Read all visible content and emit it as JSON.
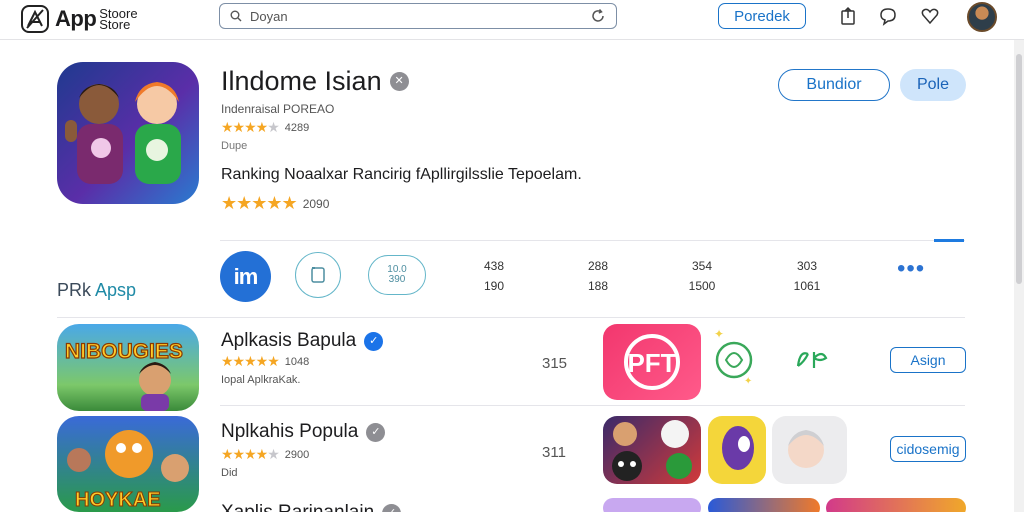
{
  "topbar": {
    "logo_app": "App",
    "logo_line1": "Stoore",
    "logo_line2": "Store",
    "search_value": "Doyan",
    "top_button": "Poredek"
  },
  "hero": {
    "title": "Ilndome Isian",
    "developer": "Indenraisal POREAO",
    "rating_count": "4289",
    "type": "Dupe",
    "ranking": "Ranking Noaalxar Rancirig fApllirgilsslie Tepoelam.",
    "rating_count2": "2090",
    "button_primary": "Bundior",
    "button_secondary": "Pole"
  },
  "stats_row": {
    "section_label_a": "PRk ",
    "section_label_b": "Apsp",
    "circle_solid": "im",
    "circle_small_top": "10.0",
    "circle_small_bottom": "390",
    "stats": [
      {
        "top": "438",
        "bottom": "190"
      },
      {
        "top": "288",
        "bottom": "188"
      },
      {
        "top": "354",
        "bottom": "1500"
      },
      {
        "top": "303",
        "bottom": "1061"
      }
    ],
    "more": "•••"
  },
  "list": [
    {
      "title": "Aplkasis Bapula",
      "rating_count": "1048",
      "subtitle": "Iopal AplkraKak.",
      "rank": "315",
      "featured_tile_text": "PFT",
      "button": "Asign"
    },
    {
      "title": "Nplkahis Popula",
      "rating_count": "2900",
      "subtitle": "Did",
      "rank": "311",
      "button": "cidosemig"
    },
    {
      "title": "Xaplis Rarinanlain"
    }
  ],
  "colors": {
    "accent": "#1a73c8",
    "star": "#f5a623",
    "tile_pink": "#f2376e"
  }
}
